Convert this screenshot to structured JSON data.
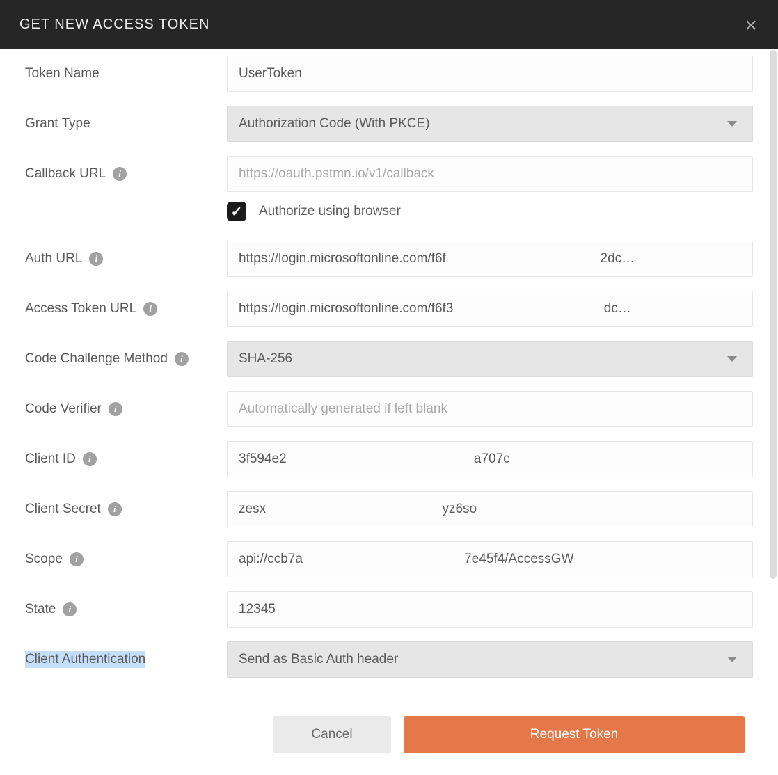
{
  "header": {
    "title": "GET NEW ACCESS TOKEN"
  },
  "labels": {
    "tokenName": "Token Name",
    "grantType": "Grant Type",
    "callbackUrl": "Callback URL",
    "authorizeBrowser": "Authorize using browser",
    "authUrl": "Auth URL",
    "accessTokenUrl": "Access Token URL",
    "codeChallengeMethod": "Code Challenge Method",
    "codeVerifier": "Code Verifier",
    "clientId": "Client ID",
    "clientSecret": "Client Secret",
    "scope": "Scope",
    "state": "State",
    "clientAuth": "Client Authentication"
  },
  "values": {
    "tokenName": "UserToken",
    "grantType": "Authorization Code (With PKCE)",
    "callbackPlaceholder": "https://oauth.pstmn.io/v1/callback",
    "authorizeBrowserChecked": true,
    "authUrl": "https://login.microsoftonline.com/f6f                                          2dc…",
    "accessTokenUrl": "https://login.microsoftonline.com/f6f3                                         dc…",
    "codeChallengeMethod": "SHA-256",
    "codeVerifierPlaceholder": "Automatically generated if left blank",
    "clientId": "3f594e2                                                   a707c",
    "clientSecret": "zesx                                                yz6so",
    "scope": "api://ccb7a                                            7e45f4/AccessGW",
    "state": "12345",
    "clientAuth": "Send as Basic Auth header"
  },
  "buttons": {
    "cancel": "Cancel",
    "request": "Request Token"
  }
}
